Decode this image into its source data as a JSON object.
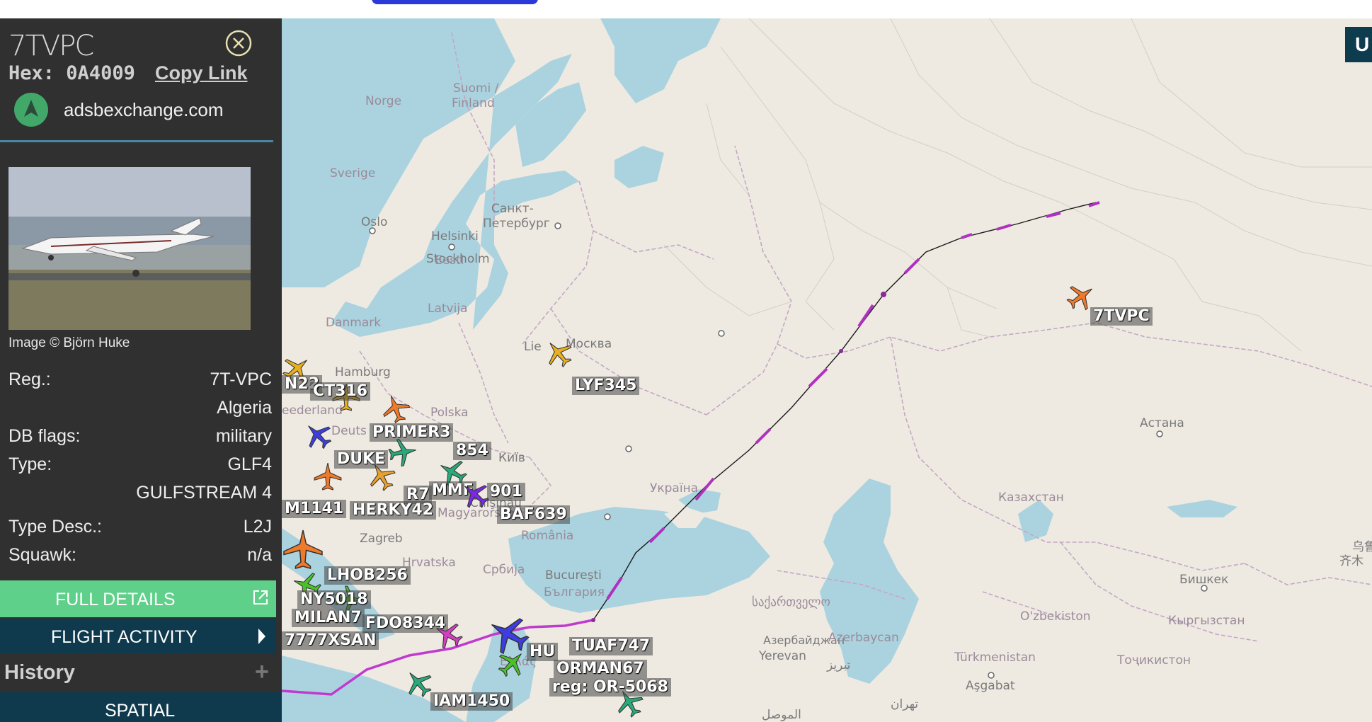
{
  "panel": {
    "callsign": "7TVPC",
    "hex_label": "Hex:",
    "hex": "0A4009",
    "copy_link": "Copy Link",
    "source": "adsbexchange.com",
    "image_credit": "Image © Björn Huke",
    "fields": [
      {
        "label": "Reg.:",
        "value": "7T-VPC"
      },
      {
        "label": "",
        "value": "Algeria"
      },
      {
        "label": "DB flags:",
        "value": "military"
      },
      {
        "label": "Type:",
        "value": "GLF4"
      },
      {
        "label": "",
        "value": "GULFSTREAM 4"
      },
      {
        "label": "Type Desc.:",
        "value": "L2J"
      },
      {
        "label": "Squawk:",
        "value": "n/a"
      }
    ],
    "full_details": "FULL DETAILS",
    "flight_activity": "FLIGHT ACTIVITY",
    "history": "History",
    "history_toggle": "+",
    "spatial": "SPATIAL"
  },
  "map": {
    "corner_button": "U",
    "places": [
      "Norge",
      "Suomi /",
      "Finland",
      "Sverige",
      "Oslo",
      "Санкт-",
      "Петербург",
      "Helsinki",
      "Stockholm",
      "Eesti",
      "Latvija",
      "Москва",
      "Danmark",
      "Hamburg",
      "Polska",
      "Київ",
      "Україна",
      "Chişinău",
      "România",
      "Zagreb",
      "Bucureşti",
      "България",
      "Hrvatska",
      "Србија",
      "Magyarország",
      "Ελλάς",
      "საქართველო",
      "Азербайджан",
      "Azerbaycan",
      "Türkmenistan",
      "Aşgabat",
      "Казахстан",
      "Астана",
      "O'zbekiston",
      "Кыргызстан",
      "Бишкек",
      "Тоҷикистон",
      "乌鲁",
      "齐木",
      "Lie",
      "eederland",
      "Deuts",
      "Yerevan",
      "تبریز",
      "تهران",
      "الموصل"
    ],
    "aircraft": [
      {
        "label": "7TVPC",
        "color": "#f07a2a"
      },
      {
        "label": "LYF345",
        "color": "#e8b020"
      },
      {
        "label": "N22",
        "color": "#e8b020"
      },
      {
        "label": "CT316",
        "color": "#e8b020"
      },
      {
        "label": "PRIMER3",
        "color": "#f07a2a"
      },
      {
        "label": "854",
        "color": "#2aa87a"
      },
      {
        "label": "DUKE",
        "color": "#3d3de0"
      },
      {
        "label": "R7",
        "color": "#f07a2a"
      },
      {
        "label": "MMF",
        "color": "#2aa87a"
      },
      {
        "label": "901",
        "color": "#7a2ae0"
      },
      {
        "label": "BAF639",
        "color": "#7a2ae0"
      },
      {
        "label": "HERKY42",
        "color": "#e8a030"
      },
      {
        "label": "M1141",
        "color": "#f07a2a"
      },
      {
        "label": "LHOB256",
        "color": "#4cc02a"
      },
      {
        "label": "NY5018",
        "color": "#4cc02a"
      },
      {
        "label": "MILAN7",
        "color": "#3d3de0"
      },
      {
        "label": "FDO8344",
        "color": "#2aa87a"
      },
      {
        "label": "7777XSAN",
        "color": "#3d3de0"
      },
      {
        "label": "IAM1450",
        "color": "#2aa87a"
      },
      {
        "label": "HU",
        "color": "#d040c0"
      },
      {
        "label": "TUAF747",
        "color": "#3d3de0"
      },
      {
        "label": "ORMAN67",
        "color": "#4cc02a"
      },
      {
        "label": "reg: OR-5068",
        "color": "#2aa87a"
      }
    ],
    "track_colors": {
      "line": "#1a1a1a",
      "dash": "#b030c0",
      "south": "#c03acf"
    },
    "water_color": "#aad3df",
    "land_color": "#eeeae2"
  }
}
